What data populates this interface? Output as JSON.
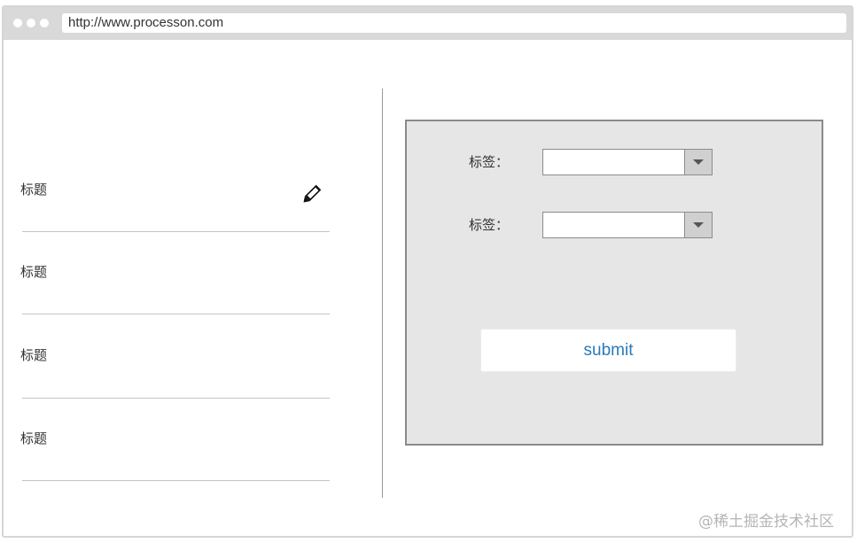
{
  "browser": {
    "url": "http://www.processon.com"
  },
  "list": {
    "items": [
      {
        "title": "标题"
      },
      {
        "title": "标题"
      },
      {
        "title": "标题"
      },
      {
        "title": "标题"
      }
    ],
    "edit_icon": "pencil-icon"
  },
  "form": {
    "fields": [
      {
        "label": "标签：",
        "value": ""
      },
      {
        "label": "标签：",
        "value": ""
      }
    ],
    "submit_label": "submit"
  },
  "watermark": "@稀土掘金技术社区",
  "colors": {
    "panel_bg": "#e6e6e6",
    "link_blue": "#2a7ab8"
  }
}
